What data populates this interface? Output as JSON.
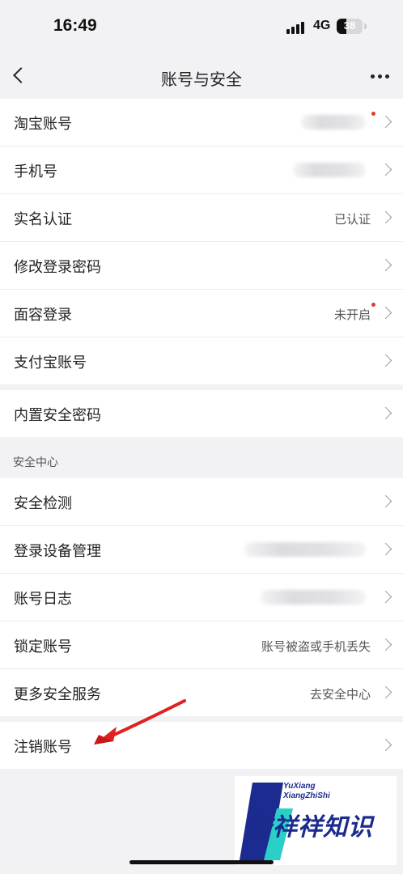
{
  "status_bar": {
    "time": "16:49",
    "network": "4G",
    "battery_level": "38",
    "battery_fraction": 0.38
  },
  "nav": {
    "title": "账号与安全",
    "back_icon": "chevron-left-icon",
    "more_icon": "more-horizontal-icon"
  },
  "group1": {
    "items": [
      {
        "label": "淘宝账号",
        "value": "",
        "notification_dot": true
      },
      {
        "label": "手机号",
        "value": ""
      },
      {
        "label": "实名认证",
        "value": "已认证"
      },
      {
        "label": "修改登录密码",
        "value": ""
      },
      {
        "label": "面容登录",
        "value": "未开启",
        "notification_dot": true
      },
      {
        "label": "支付宝账号",
        "value": ""
      }
    ]
  },
  "group2": {
    "items": [
      {
        "label": "内置安全密码",
        "value": ""
      }
    ]
  },
  "security_center": {
    "header": "安全中心",
    "items": [
      {
        "label": "安全检测",
        "value": ""
      },
      {
        "label": "登录设备管理",
        "value": ""
      },
      {
        "label": "账号日志",
        "value": ""
      },
      {
        "label": "锁定账号",
        "value": "账号被盗或手机丢失"
      },
      {
        "label": "更多安全服务",
        "value": "去安全中心"
      }
    ]
  },
  "group4": {
    "items": [
      {
        "label": "注销账号",
        "value": ""
      }
    ]
  },
  "annotation": {
    "arrow_color": "#e02020"
  },
  "watermark": {
    "line1": "YuXiang",
    "line2": "XiangZhiShi",
    "chinese": "誉祥祥知识"
  },
  "colors": {
    "background": "#f2f2f4",
    "dot": "#e23b2e"
  }
}
